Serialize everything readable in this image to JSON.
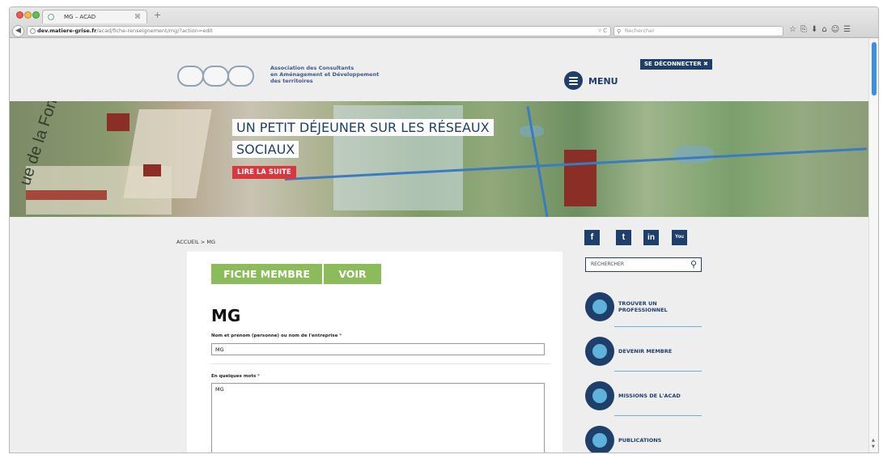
{
  "browser": {
    "tab_title": "MG – ACAD",
    "tab_close": "⌘",
    "new_tab": "+",
    "url_host": "dev.matiere-grise.fr",
    "url_path": "/acad/fiche-renseignement/mg/?action=edit",
    "search_placeholder": "Rechercher"
  },
  "header": {
    "logo_line1": "Association des Consultants",
    "logo_line2": "en Aménagement et Développement",
    "logo_line3": "des territoires",
    "menu_label": "MENU",
    "logout_label": "SE DÉCONNECTER ✖"
  },
  "hero": {
    "street_label": "ue de la Font de",
    "title_line1": "UN PETIT DÉJEUNER SUR LES RÉSEAUX",
    "title_line2": "SOCIAUX",
    "cta": "LIRE LA SUITE"
  },
  "breadcrumb": "ACCUEIL > MG",
  "main": {
    "tabs": [
      {
        "label": "FICHE MEMBRE"
      },
      {
        "label": "VOIR"
      }
    ],
    "title": "MG",
    "fields": [
      {
        "label": "Nom et prénom (personne) ou nom de l'entreprise",
        "required_mark": "*",
        "value": "MG"
      },
      {
        "label": "En quelques mots",
        "required_mark": "*",
        "value": "MG"
      }
    ]
  },
  "sidebar": {
    "social": [
      {
        "icon": "facebook-icon",
        "glyph": "f"
      },
      {
        "icon": "twitter-icon",
        "glyph": "t"
      },
      {
        "icon": "linkedin-icon",
        "glyph": "in"
      },
      {
        "icon": "youtube-icon",
        "glyph": "You"
      }
    ],
    "search_placeholder": "RECHERCHER",
    "items": [
      {
        "label": "TROUVER UN PROFESSIONNEL",
        "icon": "globe-people-icon"
      },
      {
        "label": "DEVENIR MEMBRE",
        "icon": "people-icon"
      },
      {
        "label": "MISSIONS DE L'ACAD",
        "icon": "lightbulb-icon"
      },
      {
        "label": "PUBLICATIONS",
        "icon": "document-icon"
      }
    ]
  },
  "colors": {
    "navy": "#1e3f6a",
    "green": "#8cbb5c",
    "red": "#d9363e",
    "accent_blue": "#6fb1d6"
  }
}
